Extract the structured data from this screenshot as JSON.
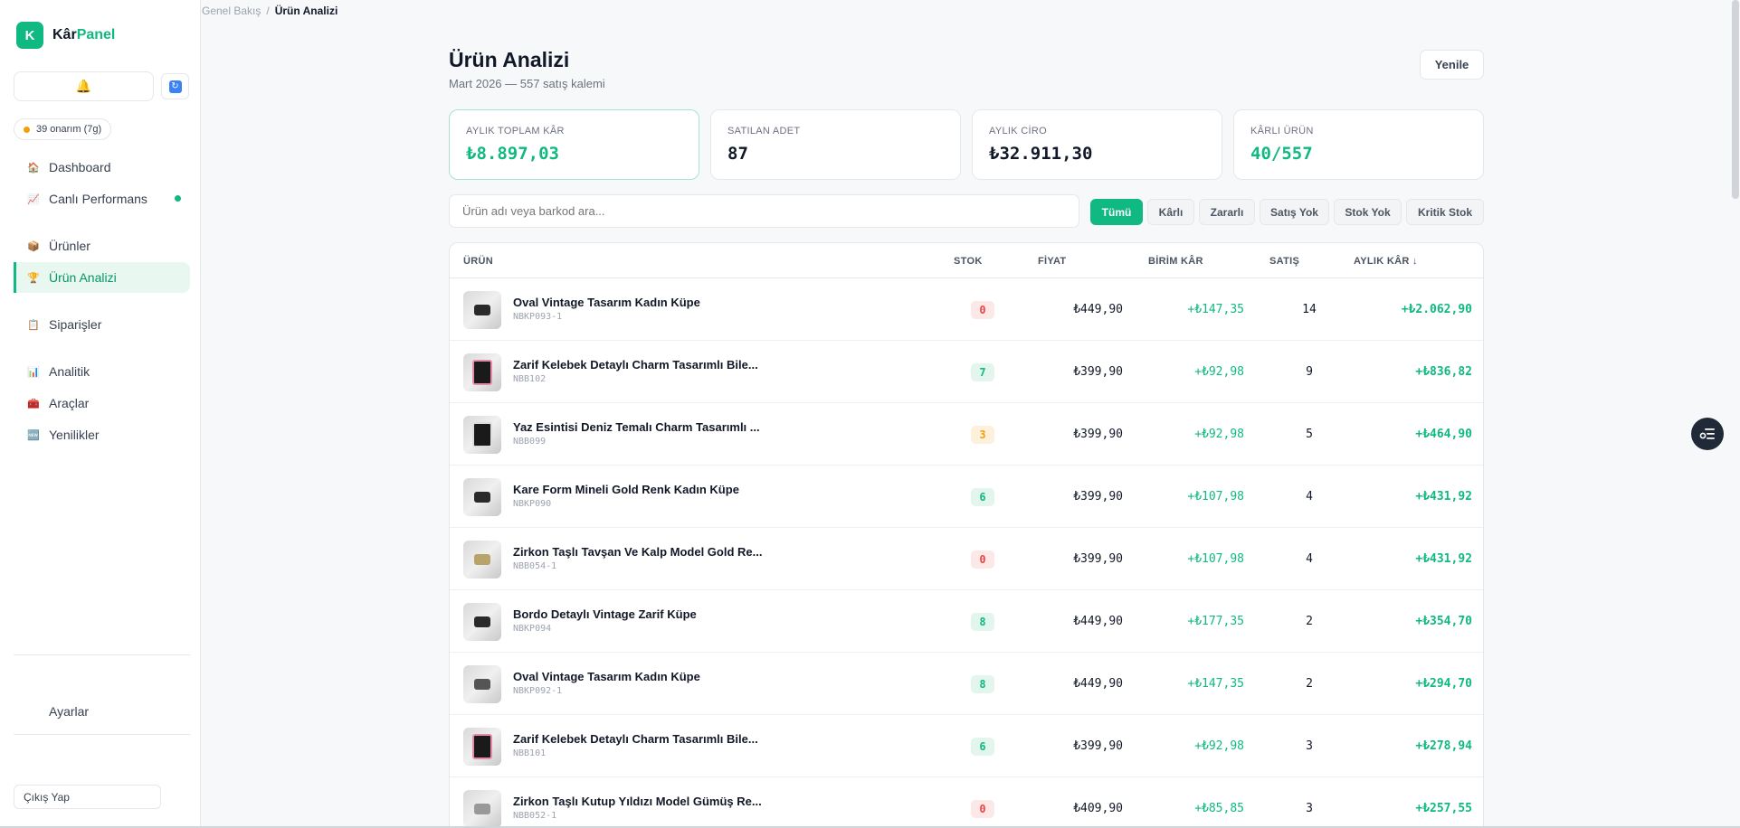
{
  "brand": {
    "initial": "K",
    "name_part1": "Kâr",
    "name_part2": "Panel"
  },
  "sidebar": {
    "approval": "39 onarım (7g)",
    "items": [
      {
        "label": "Dashboard",
        "icon": "home-icon"
      },
      {
        "label": "Canlı Performans",
        "icon": "pulse-icon"
      },
      {
        "label": "Ürünler",
        "icon": "box-icon"
      },
      {
        "label": "Ürün Analizi",
        "icon": "trophy-icon"
      },
      {
        "label": "Siparişler",
        "icon": "clipboard-icon"
      },
      {
        "label": "Analitik",
        "icon": "bar-chart-icon"
      },
      {
        "label": "Araçlar",
        "icon": "tools-icon"
      },
      {
        "label": "Yenilikler",
        "icon": "new-badge-icon"
      }
    ],
    "settings": "Ayarlar",
    "logout": "Çıkış Yap"
  },
  "breadcrumb": {
    "parent": "Genel Bakış",
    "separator": "/",
    "current": "Ürün Analizi"
  },
  "header": {
    "title": "Ürün Analizi",
    "subtitle": "Mart 2026 — 557 satış kalemi",
    "refresh": "Yenile"
  },
  "kpis": [
    {
      "label": "AYLIK TOPLAM KÂR",
      "value": "₺8.897,03"
    },
    {
      "label": "SATILAN ADET",
      "value": "87"
    },
    {
      "label": "AYLIK CİRO",
      "value": "₺32.911,30"
    },
    {
      "label": "KÂRLI ÜRÜN",
      "value": "40/557"
    }
  ],
  "search": {
    "placeholder": "Ürün adı veya barkod ara..."
  },
  "filters": [
    "Tümü",
    "Kârlı",
    "Zararlı",
    "Satış Yok",
    "Stok Yok",
    "Kritik Stok"
  ],
  "table": {
    "headers": {
      "product": "ÜRÜN",
      "stock": "STOK",
      "price": "FİYAT",
      "unit_profit": "BİRİM KÂR",
      "sales": "SATIŞ",
      "monthly": "AYLIK KÂR ↓"
    },
    "rows": [
      {
        "name": "Oval Vintage Tasarım Kadın Küpe",
        "code": "NBKP093-1",
        "stock": "0",
        "price": "₺449,90",
        "unit": "+₺147,35",
        "sales": "14",
        "monthly": "+₺2.062,90"
      },
      {
        "name": "Zarif Kelebek Detaylı Charm Tasarımlı Bile...",
        "code": "NBB102",
        "stock": "7",
        "price": "₺399,90",
        "unit": "+₺92,98",
        "sales": "9",
        "monthly": "+₺836,82"
      },
      {
        "name": "Yaz Esintisi Deniz Temalı Charm Tasarımlı ...",
        "code": "NBB099",
        "stock": "3",
        "price": "₺399,90",
        "unit": "+₺92,98",
        "sales": "5",
        "monthly": "+₺464,90"
      },
      {
        "name": "Kare Form Mineli Gold Renk Kadın Küpe",
        "code": "NBKP090",
        "stock": "6",
        "price": "₺399,90",
        "unit": "+₺107,98",
        "sales": "4",
        "monthly": "+₺431,92"
      },
      {
        "name": "Zirkon Taşlı Tavşan Ve Kalp Model Gold Re...",
        "code": "NBB054-1",
        "stock": "0",
        "price": "₺399,90",
        "unit": "+₺107,98",
        "sales": "4",
        "monthly": "+₺431,92"
      },
      {
        "name": "Bordo Detaylı Vintage Zarif Küpe",
        "code": "NBKP094",
        "stock": "8",
        "price": "₺449,90",
        "unit": "+₺177,35",
        "sales": "2",
        "monthly": "+₺354,70"
      },
      {
        "name": "Oval Vintage Tasarım Kadın Küpe",
        "code": "NBKP092-1",
        "stock": "8",
        "price": "₺449,90",
        "unit": "+₺147,35",
        "sales": "2",
        "monthly": "+₺294,70"
      },
      {
        "name": "Zarif Kelebek Detaylı Charm Tasarımlı Bile...",
        "code": "NBB101",
        "stock": "6",
        "price": "₺399,90",
        "unit": "+₺92,98",
        "sales": "3",
        "monthly": "+₺278,94"
      },
      {
        "name": "Zirkon Taşlı Kutup Yıldızı Model Gümüş Re...",
        "code": "NBB052-1",
        "stock": "0",
        "price": "₺409,90",
        "unit": "+₺85,85",
        "sales": "3",
        "monthly": "+₺257,55"
      }
    ]
  }
}
